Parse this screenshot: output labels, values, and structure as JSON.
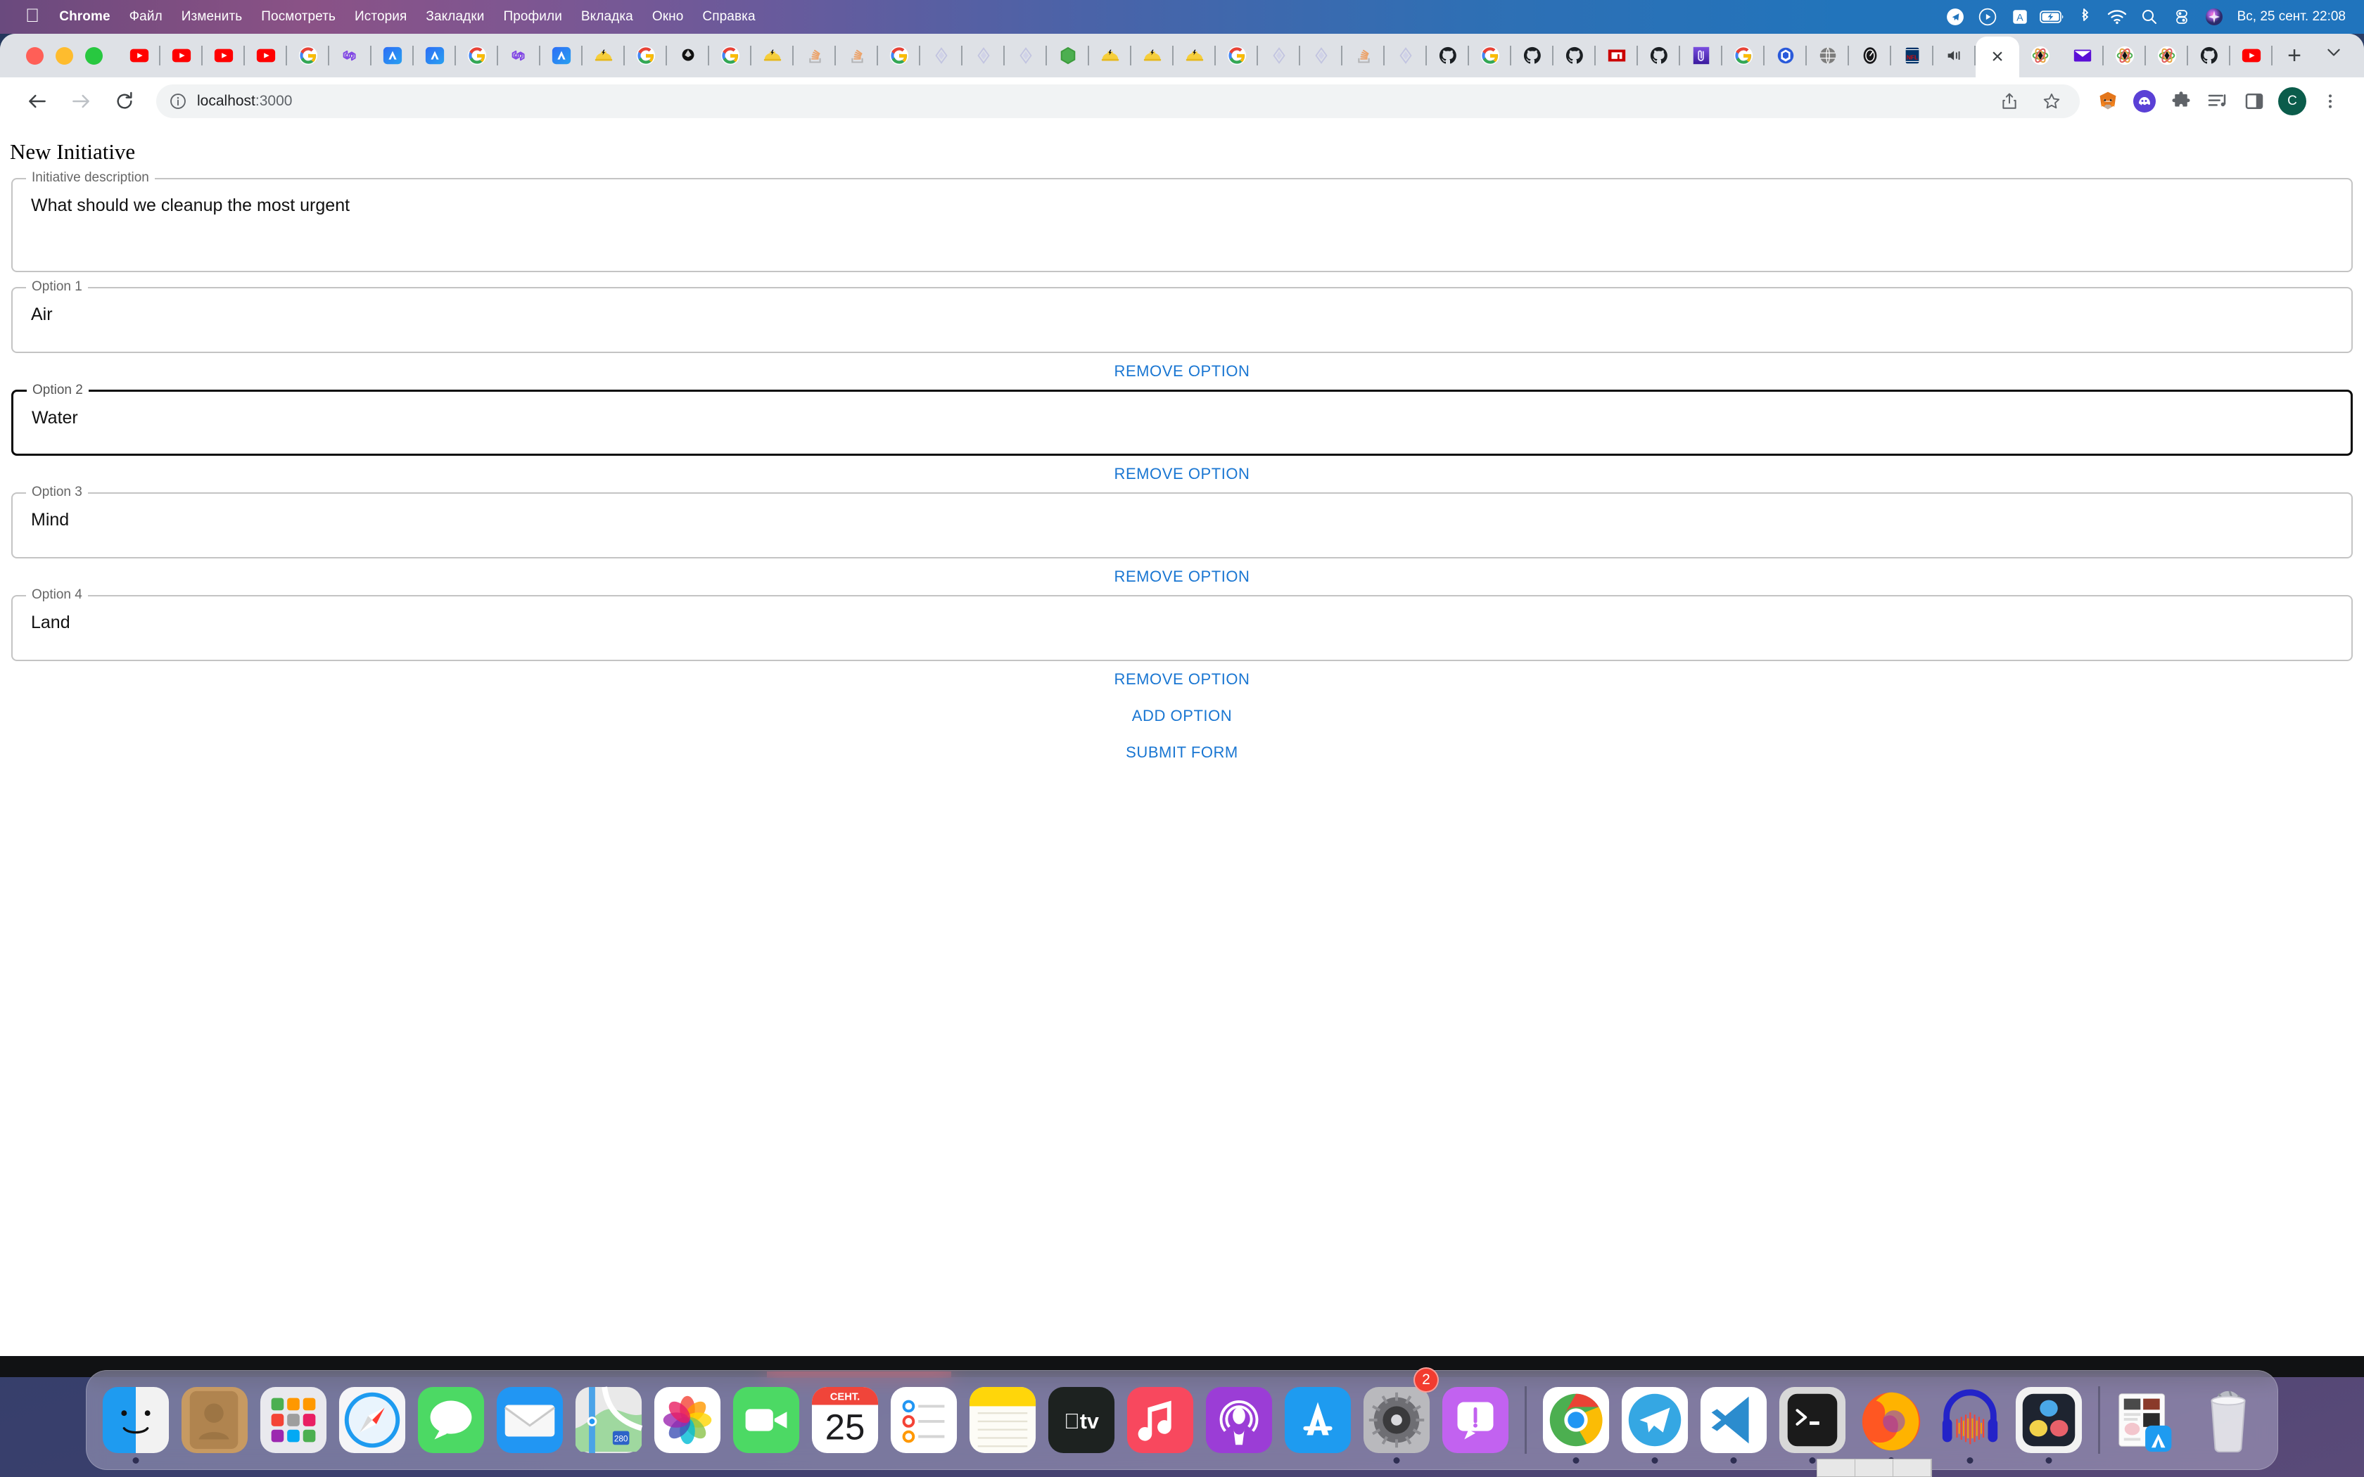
{
  "menubar": {
    "apple_logo": "apple-logo",
    "items": [
      {
        "label": "Chrome",
        "bold": true
      },
      {
        "label": "Файл",
        "bold": false
      },
      {
        "label": "Изменить",
        "bold": false
      },
      {
        "label": "Посмотреть",
        "bold": false
      },
      {
        "label": "История",
        "bold": false
      },
      {
        "label": "Закладки",
        "bold": false
      },
      {
        "label": "Профили",
        "bold": false
      },
      {
        "label": "Вкладка",
        "bold": false
      },
      {
        "label": "Окно",
        "bold": false
      },
      {
        "label": "Справка",
        "bold": false
      }
    ],
    "status_icons": [
      "telegram-icon",
      "play-circle-icon",
      "input-source-A-icon",
      "battery-charging-icon",
      "bluetooth-icon",
      "wifi-icon",
      "search-icon",
      "control-center-icon",
      "siri-icon"
    ],
    "clock": "Вс, 25 сент.  22:08"
  },
  "browser": {
    "traffic_lights": [
      "close-button",
      "minimize-button",
      "maximize-button"
    ],
    "tabs": [
      {
        "favicon": "youtube-icon"
      },
      {
        "favicon": "youtube-icon"
      },
      {
        "favicon": "youtube-icon"
      },
      {
        "favicon": "youtube-icon"
      },
      {
        "favicon": "google-icon"
      },
      {
        "favicon": "polygon-icon"
      },
      {
        "favicon": "arbitrum-icon"
      },
      {
        "favicon": "arbitrum-icon"
      },
      {
        "favicon": "google-icon"
      },
      {
        "favicon": "polygon-icon"
      },
      {
        "favicon": "arbitrum-icon"
      },
      {
        "favicon": "hardhat-icon"
      },
      {
        "favicon": "google-icon"
      },
      {
        "favicon": "ethereum-dark-icon"
      },
      {
        "favicon": "google-icon"
      },
      {
        "favicon": "hardhat-icon"
      },
      {
        "favicon": "stackoverflow-icon"
      },
      {
        "favicon": "stackoverflow-icon"
      },
      {
        "favicon": "google-icon"
      },
      {
        "favicon": "hardhat-faded-icon"
      },
      {
        "favicon": "hardhat-faded-icon"
      },
      {
        "favicon": "hardhat-faded-icon"
      },
      {
        "favicon": "nodejs-icon"
      },
      {
        "favicon": "hardhat-icon"
      },
      {
        "favicon": "hardhat-icon"
      },
      {
        "favicon": "hardhat-icon"
      },
      {
        "favicon": "google-icon"
      },
      {
        "favicon": "hardhat-faded-icon"
      },
      {
        "favicon": "hardhat-faded-icon"
      },
      {
        "favicon": "stackoverflow-icon"
      },
      {
        "favicon": "hardhat-faded-icon"
      },
      {
        "favicon": "github-icon"
      },
      {
        "favicon": "google-icon"
      },
      {
        "favicon": "github-icon"
      },
      {
        "favicon": "github-icon"
      },
      {
        "favicon": "npm-icon"
      },
      {
        "favicon": "github-icon"
      },
      {
        "favicon": "paperclip-icon"
      },
      {
        "favicon": "google-icon"
      },
      {
        "favicon": "chainlink-icon"
      },
      {
        "favicon": "globe-icon"
      },
      {
        "favicon": "speedometer-icon"
      },
      {
        "favicon": "nfl-icon"
      },
      {
        "favicon": "speaker-playing-icon"
      }
    ],
    "active_tab": {
      "close_label": "×",
      "favicon": "react-atom-icon"
    },
    "tabs_after_active": [
      {
        "favicon": "react-atom-icon"
      },
      {
        "favicon": "mail-purple-icon"
      },
      {
        "favicon": "react-atom-icon"
      },
      {
        "favicon": "react-atom-icon"
      },
      {
        "favicon": "github-icon"
      },
      {
        "favicon": "youtube-icon"
      }
    ],
    "new_tab_label": "+",
    "tab_list_chevron": "chevron-down-icon",
    "toolbar": {
      "back": "back-arrow-icon",
      "forward": "forward-arrow-icon",
      "reload": "reload-icon",
      "site_info": "info-circle-icon",
      "url": "localhost:3000",
      "url_host": "localhost",
      "url_port": ":3000",
      "share": "share-icon",
      "bookmark": "star-icon",
      "extensions": [
        "metamask-icon",
        "phantom-icon",
        "extensions-puzzle-icon",
        "media-playlist-icon",
        "side-panel-icon"
      ],
      "profile_initial": "C",
      "menu": "three-dots-icon"
    }
  },
  "page": {
    "title": "New Initiative",
    "description_field": {
      "legend": "Initiative description",
      "value": "What should we cleanup the most urgent"
    },
    "options": [
      {
        "legend": "Option 1",
        "value": "Air",
        "focused": false,
        "remove_label": "REMOVE OPTION"
      },
      {
        "legend": "Option 2",
        "value": "Water",
        "focused": true,
        "remove_label": "REMOVE OPTION"
      },
      {
        "legend": "Option 3",
        "value": "Mind",
        "focused": false,
        "remove_label": "REMOVE OPTION"
      },
      {
        "legend": "Option 4",
        "value": "Land",
        "focused": false,
        "remove_label": "REMOVE OPTION"
      }
    ],
    "add_option_label": "ADD OPTION",
    "submit_label": "SUBMIT FORM",
    "accent_color": "#1976d2"
  },
  "dock": {
    "items": [
      {
        "name": "finder",
        "running": true
      },
      {
        "name": "contacts",
        "running": false
      },
      {
        "name": "launchpad",
        "running": false
      },
      {
        "name": "safari",
        "running": false
      },
      {
        "name": "messages",
        "running": false
      },
      {
        "name": "mail",
        "running": false
      },
      {
        "name": "maps",
        "running": false
      },
      {
        "name": "photos",
        "running": false
      },
      {
        "name": "facetime",
        "running": false
      },
      {
        "name": "calendar",
        "running": false,
        "month": "СЕНТ.",
        "day": "25"
      },
      {
        "name": "reminders",
        "running": false
      },
      {
        "name": "notes",
        "running": false
      },
      {
        "name": "appletv",
        "running": false
      },
      {
        "name": "music",
        "running": false
      },
      {
        "name": "podcasts",
        "running": false
      },
      {
        "name": "appstore",
        "running": false
      },
      {
        "name": "system-preferences",
        "running": true,
        "badge": "2"
      },
      {
        "name": "alert-app",
        "running": false
      },
      {
        "name": "chrome",
        "running": true
      },
      {
        "name": "telegram",
        "running": true
      },
      {
        "name": "vscode",
        "running": true
      },
      {
        "name": "terminal",
        "running": true
      },
      {
        "name": "firefox",
        "running": true
      },
      {
        "name": "audacity",
        "running": true
      },
      {
        "name": "davinci-resolve",
        "running": true
      },
      {
        "name": "downloads-stack",
        "running": false
      },
      {
        "name": "trash",
        "running": false
      }
    ]
  }
}
